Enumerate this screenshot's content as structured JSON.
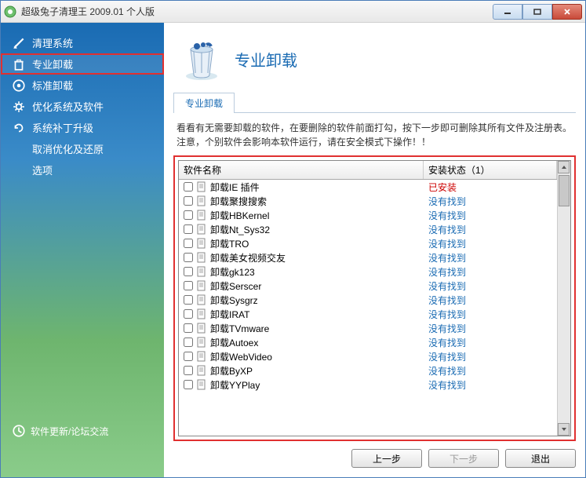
{
  "titlebar": {
    "title": "超级兔子清理王 2009.01 个人版"
  },
  "sidebar": {
    "items": [
      {
        "label": "清理系统",
        "icon": "broom"
      },
      {
        "label": "专业卸载",
        "icon": "trash",
        "highlighted": true
      },
      {
        "label": "标准卸载",
        "icon": "disc"
      },
      {
        "label": "优化系统及软件",
        "icon": "gear"
      },
      {
        "label": "系统补丁升级",
        "icon": "refresh"
      },
      {
        "label": "取消优化及还原",
        "icon": ""
      },
      {
        "label": "选项",
        "icon": ""
      }
    ],
    "footer": "软件更新/论坛交流"
  },
  "main": {
    "title": "专业卸载",
    "tab": "专业卸载",
    "instruction": "看看有无需要卸载的软件，在要删除的软件前面打勾，按下一步即可删除其所有文件及注册表。注意，个别软件会影响本软件运行，请在安全模式下操作！！",
    "columns": {
      "name": "软件名称",
      "status": "安装状态（1）"
    },
    "rows": [
      {
        "name": "卸载IE 插件",
        "status": "已安装",
        "state": "installed"
      },
      {
        "name": "卸载聚搜搜索",
        "status": "没有找到",
        "state": "notfound"
      },
      {
        "name": "卸载HBKernel",
        "status": "没有找到",
        "state": "notfound"
      },
      {
        "name": "卸载Nt_Sys32",
        "status": "没有找到",
        "state": "notfound"
      },
      {
        "name": "卸载TRO",
        "status": "没有找到",
        "state": "notfound"
      },
      {
        "name": "卸载美女视频交友",
        "status": "没有找到",
        "state": "notfound"
      },
      {
        "name": "卸载gk123",
        "status": "没有找到",
        "state": "notfound"
      },
      {
        "name": "卸载Serscer",
        "status": "没有找到",
        "state": "notfound"
      },
      {
        "name": "卸载Sysgrz",
        "status": "没有找到",
        "state": "notfound"
      },
      {
        "name": "卸载IRAT",
        "status": "没有找到",
        "state": "notfound"
      },
      {
        "name": "卸载TVmware",
        "status": "没有找到",
        "state": "notfound"
      },
      {
        "name": "卸载Autoex",
        "status": "没有找到",
        "state": "notfound"
      },
      {
        "name": "卸载WebVideo",
        "status": "没有找到",
        "state": "notfound"
      },
      {
        "name": "卸载ByXP",
        "status": "没有找到",
        "state": "notfound"
      },
      {
        "name": "卸载YYPlay",
        "status": "没有找到",
        "state": "notfound"
      }
    ],
    "buttons": {
      "prev": "上一步",
      "next": "下一步",
      "exit": "退出"
    }
  }
}
